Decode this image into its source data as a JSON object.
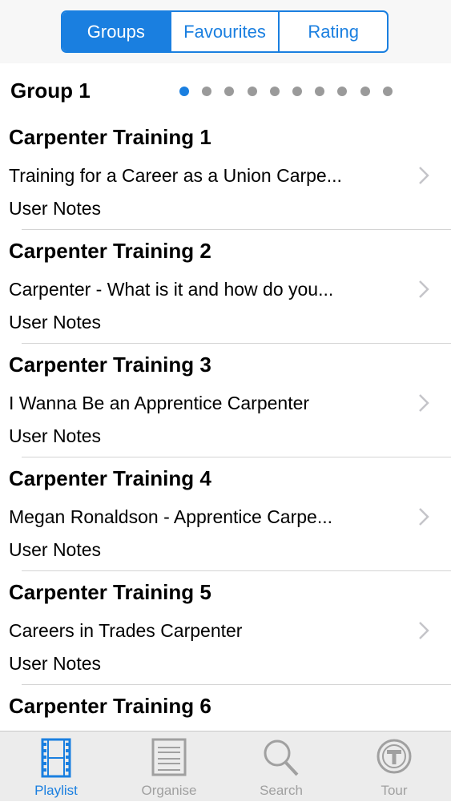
{
  "segments": [
    {
      "label": "Groups",
      "active": true
    },
    {
      "label": "Favourites",
      "active": false
    },
    {
      "label": "Rating",
      "active": false
    }
  ],
  "group": {
    "title": "Group 1",
    "page_count": 10,
    "current_page": 1
  },
  "items": [
    {
      "title": "Carpenter Training 1",
      "subtitle": "Training for a Career as a Union Carpe...",
      "notes": "User Notes"
    },
    {
      "title": "Carpenter Training 2",
      "subtitle": "Carpenter - What is it and how do you...",
      "notes": "User Notes"
    },
    {
      "title": "Carpenter Training 3",
      "subtitle": "I Wanna Be an Apprentice Carpenter",
      "notes": "User Notes"
    },
    {
      "title": "Carpenter Training 4",
      "subtitle": "Megan Ronaldson - Apprentice Carpe...",
      "notes": "User Notes"
    },
    {
      "title": "Carpenter Training 5",
      "subtitle": "Careers in Trades Carpenter",
      "notes": "User Notes"
    },
    {
      "title": "Carpenter Training 6",
      "subtitle": "",
      "notes": ""
    }
  ],
  "tabs": [
    {
      "label": "Playlist",
      "icon": "film-strip-icon",
      "active": true
    },
    {
      "label": "Organise",
      "icon": "filing-cabinet-icon",
      "active": false
    },
    {
      "label": "Search",
      "icon": "magnifier-icon",
      "active": false
    },
    {
      "label": "Tour",
      "icon": "info-sign-icon",
      "active": false
    }
  ],
  "colors": {
    "accent": "#1a7fe0",
    "inactive": "#a0a0a0"
  }
}
